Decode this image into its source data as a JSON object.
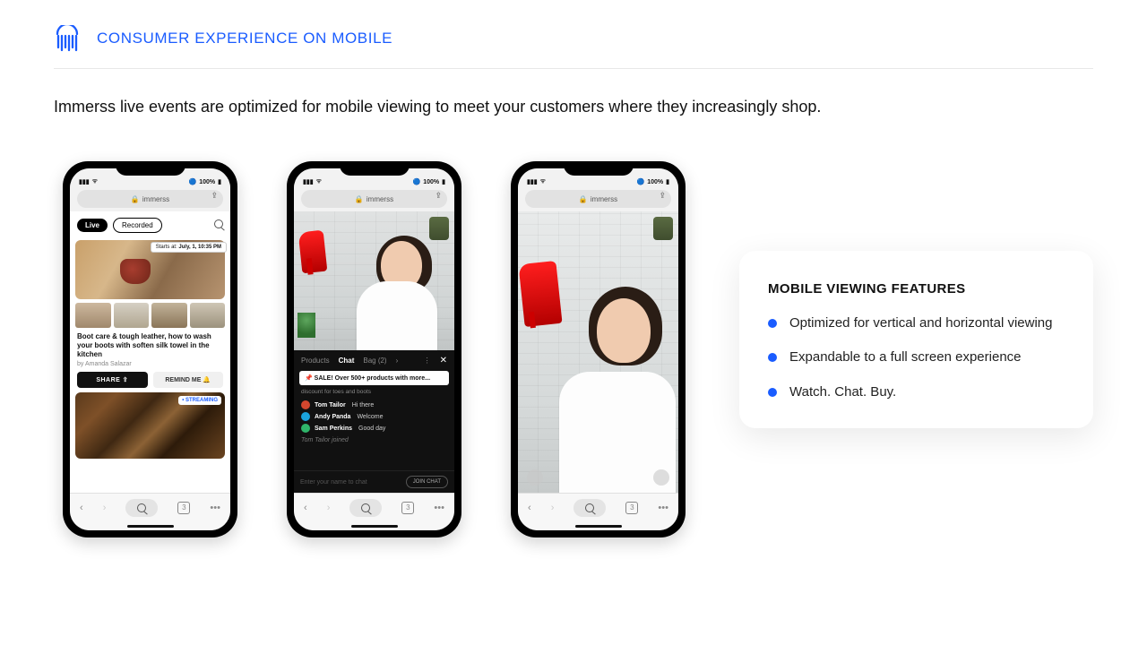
{
  "header": {
    "title": "CONSUMER EXPERIENCE ON MOBILE"
  },
  "intro": "Immerss live events are optimized for mobile viewing to meet your customers where they increasingly shop.",
  "phone_common": {
    "battery": "100%",
    "url_domain": "immerss",
    "lock_glyph": "🔒"
  },
  "phone1": {
    "tab_live": "Live",
    "tab_recorded": "Recorded",
    "starts_at_label": "Starts at:",
    "starts_at_value": "July, 1, 10:35 PM",
    "card_title": "Boot care & tough leather, how to wash your boots with soften silk towel in the kitchen",
    "by_prefix": "by",
    "author": "Amanda Salazar",
    "share_label": "SHARE",
    "remind_label": "REMIND ME",
    "streaming_badge": "• STREAMING"
  },
  "phone2": {
    "tab_products": "Products",
    "tab_chat": "Chat",
    "tab_bag": "Bag (2)",
    "sale_pin": "SALE! Over 500+ products with more...",
    "sub_line": "discount for toes and boots",
    "chat": [
      {
        "user": "Tom Tailor",
        "msg": "Hi there",
        "color": "#d2462e"
      },
      {
        "user": "Andy Panda",
        "msg": "Welcome",
        "color": "#1aa3dd"
      },
      {
        "user": "Sam Perkins",
        "msg": "Good day",
        "color": "#2fb56a"
      }
    ],
    "joined": "Tom Tailor joined",
    "input_placeholder": "Enter your name to chat",
    "join_btn": "JOIN CHAT",
    "close_glyph": "✕",
    "dots_glyph": "⋮",
    "chev_glyph": "›"
  },
  "bottom_nav": {
    "back": "‹",
    "fwd": "›",
    "tabs_count": "3",
    "more": "•••"
  },
  "features": {
    "title": "MOBILE VIEWING FEATURES",
    "items": [
      "Optimized for vertical and horizontal viewing",
      "Expandable to a full screen experience",
      "Watch.  Chat.  Buy."
    ]
  }
}
